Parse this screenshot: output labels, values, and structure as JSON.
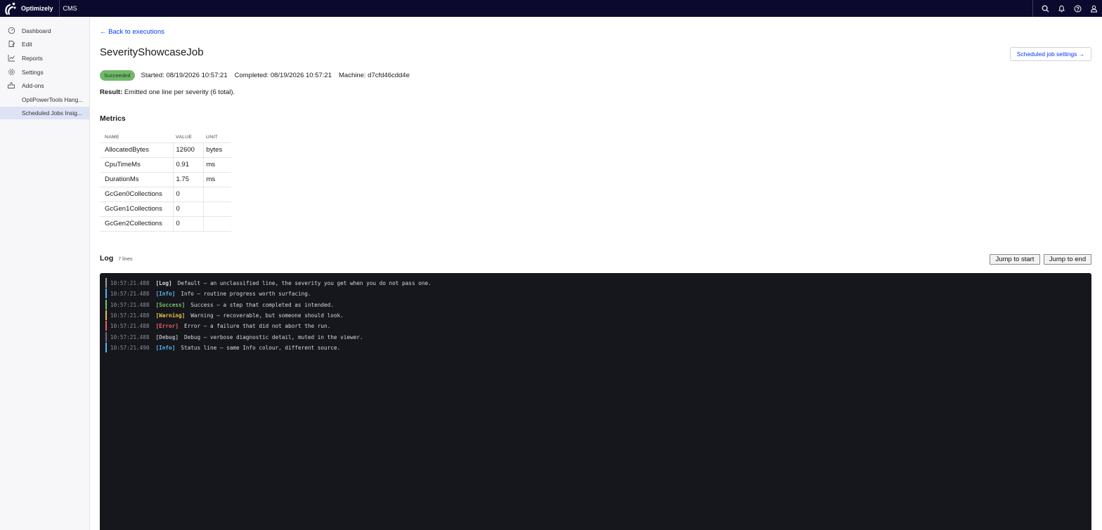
{
  "topbar": {
    "brand": "Optimizely",
    "product": "CMS",
    "icons": [
      "search-icon",
      "bell-icon",
      "help-icon",
      "user-icon"
    ]
  },
  "sidebar": {
    "items": [
      {
        "label": "Dashboard",
        "icon": "dashboard-icon"
      },
      {
        "label": "Edit",
        "icon": "edit-icon"
      },
      {
        "label": "Reports",
        "icon": "reports-icon"
      },
      {
        "label": "Settings",
        "icon": "settings-icon"
      },
      {
        "label": "Add-ons",
        "icon": "addons-icon"
      }
    ],
    "subitems": [
      {
        "label": "OptiPowerTools Hang..."
      },
      {
        "label": "Scheduled Jobs Insig...",
        "active": true
      }
    ]
  },
  "page": {
    "back_label": "← Back to executions",
    "title": "SeverityShowcaseJob",
    "settings_label": "Scheduled job settings →",
    "status": {
      "badge": "Succeeded",
      "badge_color": "#72b86b",
      "started": "Started: 08/19/2026 10:57:21",
      "completed": "Completed: 08/19/2026 10:57:21",
      "machine": "Machine: d7cfd46cdd4e"
    },
    "result_label": "Result:",
    "result_text": "Emitted one line per severity (6 total)."
  },
  "metrics": {
    "title": "Metrics",
    "columns": [
      "NAME",
      "VALUE",
      "UNIT"
    ],
    "rows": [
      {
        "name": "AllocatedBytes",
        "value": "12600",
        "unit": "bytes"
      },
      {
        "name": "CpuTimeMs",
        "value": "0.91",
        "unit": "ms"
      },
      {
        "name": "DurationMs",
        "value": "1.75",
        "unit": "ms"
      },
      {
        "name": "GcGen0Collections",
        "value": "0",
        "unit": ""
      },
      {
        "name": "GcGen1Collections",
        "value": "0",
        "unit": ""
      },
      {
        "name": "GcGen2Collections",
        "value": "0",
        "unit": ""
      }
    ]
  },
  "log": {
    "title": "Log",
    "count": "7 lines",
    "jump_start": "Jump to start",
    "jump_end": "Jump to end",
    "lines": [
      {
        "ts": "10:57:21.488",
        "tag": "[Log]",
        "msg": "Default — an unclassified line, the severity you get when you do not pass one.",
        "color": "#d7d9de",
        "bar": "#9a9da5"
      },
      {
        "ts": "10:57:21.488",
        "tag": "[Info]",
        "msg": "Info — routine progress worth surfacing.",
        "color": "#5ab3f0",
        "bar": "#5ab3f0"
      },
      {
        "ts": "10:57:21.488",
        "tag": "[Success]",
        "msg": "Success — a step that completed as intended.",
        "color": "#7cc46f",
        "bar": "#7cc46f"
      },
      {
        "ts": "10:57:21.488",
        "tag": "[Warning]",
        "msg": "Warning — recoverable, but someone should look.",
        "color": "#e8c04a",
        "bar": "#e8c04a"
      },
      {
        "ts": "10:57:21.488",
        "tag": "[Error]",
        "msg": "Error — a failure that did not abort the run.",
        "color": "#f0605a",
        "bar": "#f0605a"
      },
      {
        "ts": "10:57:21.488",
        "tag": "[Debug]",
        "msg": "Debug — verbose diagnostic detail, muted in the viewer.",
        "color": "#a9adb6",
        "bar": "#6d717a"
      },
      {
        "ts": "10:57:21.490",
        "tag": "[Info]",
        "msg": "Status line — same Info colour, different source.",
        "color": "#5ab3f0",
        "bar": "#5ab3f0"
      }
    ]
  }
}
